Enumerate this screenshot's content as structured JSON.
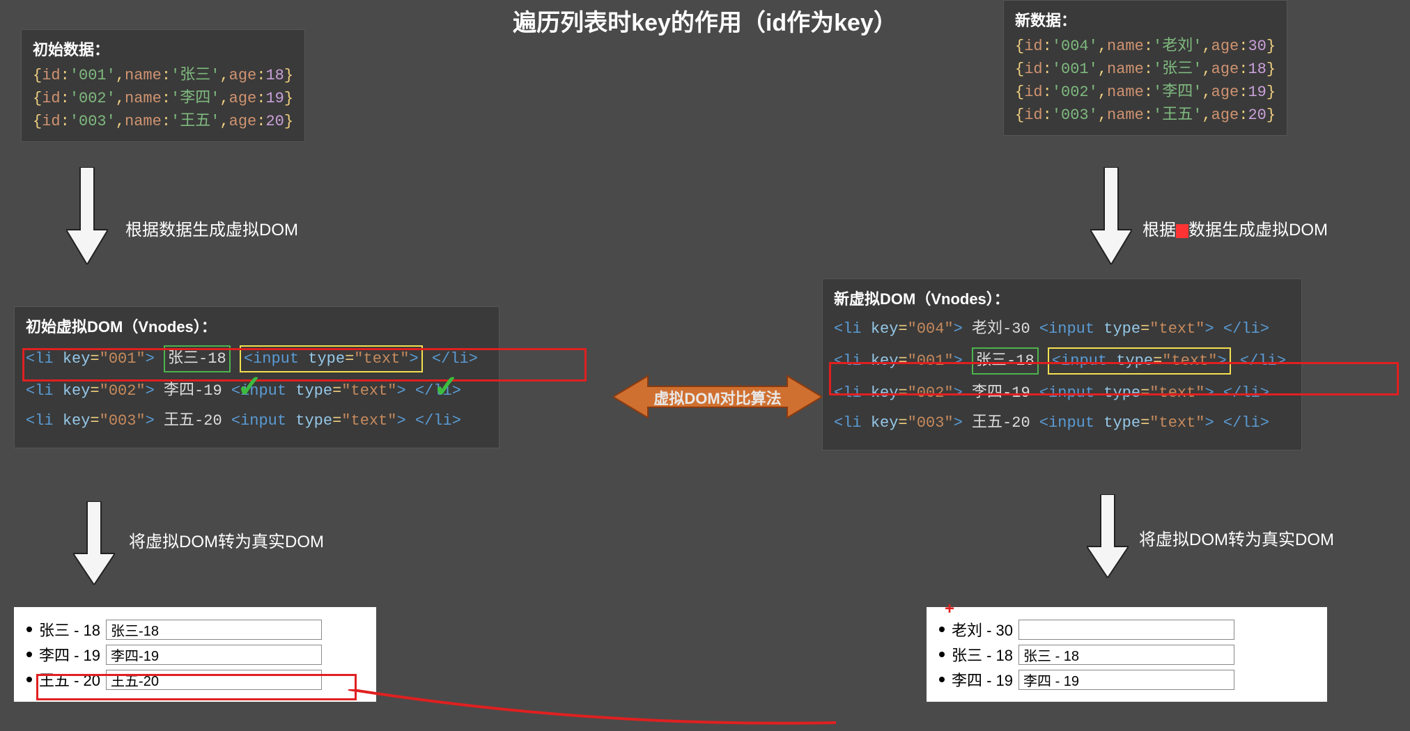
{
  "title": "遍历列表时key的作用（id作为key）",
  "initial_data": {
    "label": "初始数据：",
    "rows": [
      {
        "id": "'001'",
        "name": "'张三'",
        "age": "18"
      },
      {
        "id": "'002'",
        "name": "'李四'",
        "age": "19"
      },
      {
        "id": "'003'",
        "name": "'王五'",
        "age": "20"
      }
    ]
  },
  "new_data": {
    "label": "新数据：",
    "rows": [
      {
        "id": "'004'",
        "name": "'老刘'",
        "age": "30"
      },
      {
        "id": "'001'",
        "name": "'张三'",
        "age": "18"
      },
      {
        "id": "'002'",
        "name": "'李四'",
        "age": "19"
      },
      {
        "id": "'003'",
        "name": "'王五'",
        "age": "20"
      }
    ]
  },
  "arrows": {
    "gen_initial": "根据数据生成虚拟DOM",
    "gen_new_prefix": "根据",
    "gen_new_suffix": "数据生成虚拟DOM",
    "to_real_left": "将虚拟DOM转为真实DOM",
    "to_real_right": "将虚拟DOM转为真实DOM",
    "compare": "虚拟DOM对比算法"
  },
  "initial_vdom": {
    "label": "初始虚拟DOM（Vnodes）：",
    "rows": [
      {
        "key": "\"001\"",
        "text": "张三-18",
        "input": "<input type=\"text\">"
      },
      {
        "key": "\"002\"",
        "text": "李四-19",
        "input": "<input type=\"text\">"
      },
      {
        "key": "\"003\"",
        "text": "王五-20",
        "input": "<input type=\"text\">"
      }
    ]
  },
  "new_vdom": {
    "label": "新虚拟DOM（Vnodes）：",
    "rows": [
      {
        "key": "\"004\"",
        "text": "老刘-30",
        "input": "<input type=\"text\">"
      },
      {
        "key": "\"001\"",
        "text": "张三-18",
        "input": "<input type=\"text\">"
      },
      {
        "key": "\"002\"",
        "text": "李四-19",
        "input": "<input type=\"text\">"
      },
      {
        "key": "\"003\"",
        "text": "王五-20",
        "input": "<input type=\"text\">"
      }
    ]
  },
  "real_dom_left": {
    "rows": [
      {
        "label": "张三 - 18",
        "value": "张三-18"
      },
      {
        "label": "李四 - 19",
        "value": "李四-19"
      },
      {
        "label": "王五 - 20",
        "value": "王五-20"
      }
    ]
  },
  "real_dom_right": {
    "rows": [
      {
        "label": "老刘 - 30",
        "value": ""
      },
      {
        "label": "张三 - 18",
        "value": "张三 - 18"
      },
      {
        "label": "李四 - 19",
        "value": "李四 - 19"
      }
    ]
  },
  "plus_marker": "+"
}
